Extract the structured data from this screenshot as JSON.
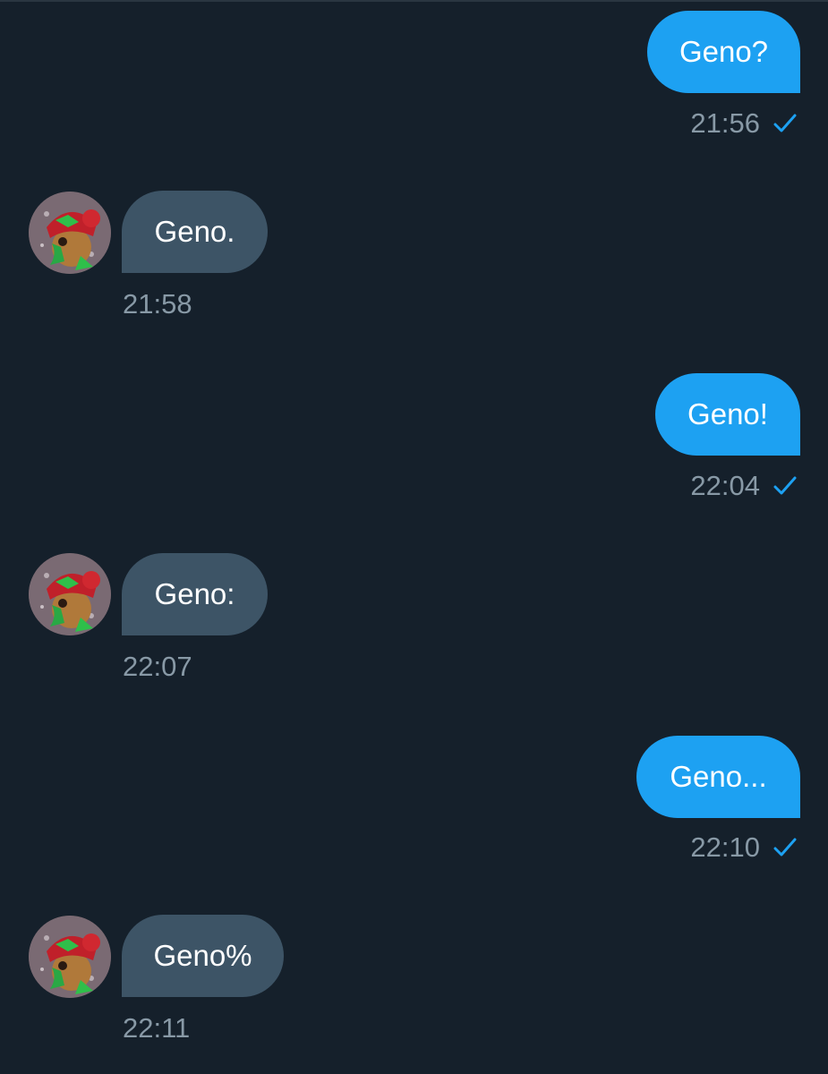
{
  "conversation": {
    "messages": [
      {
        "direction": "outgoing",
        "text": "Geno?",
        "time": "21:56",
        "read": true
      },
      {
        "direction": "incoming",
        "text": "Geno.",
        "time": "21:58"
      },
      {
        "direction": "outgoing",
        "text": "Geno!",
        "time": "22:04",
        "read": true
      },
      {
        "direction": "incoming",
        "text": "Geno:",
        "time": "22:07"
      },
      {
        "direction": "outgoing",
        "text": "Geno...",
        "time": "22:10",
        "read": true
      },
      {
        "direction": "incoming",
        "text": "Geno%",
        "time": "22:11"
      }
    ]
  },
  "colors": {
    "background": "#15202b",
    "outgoing_bubble": "#1da1f2",
    "incoming_bubble": "#3d5466",
    "timestamp": "#8899a6",
    "check": "#1da1f2"
  },
  "icons": {
    "read_receipt": "checkmark-icon",
    "avatar": "geno-avatar"
  }
}
